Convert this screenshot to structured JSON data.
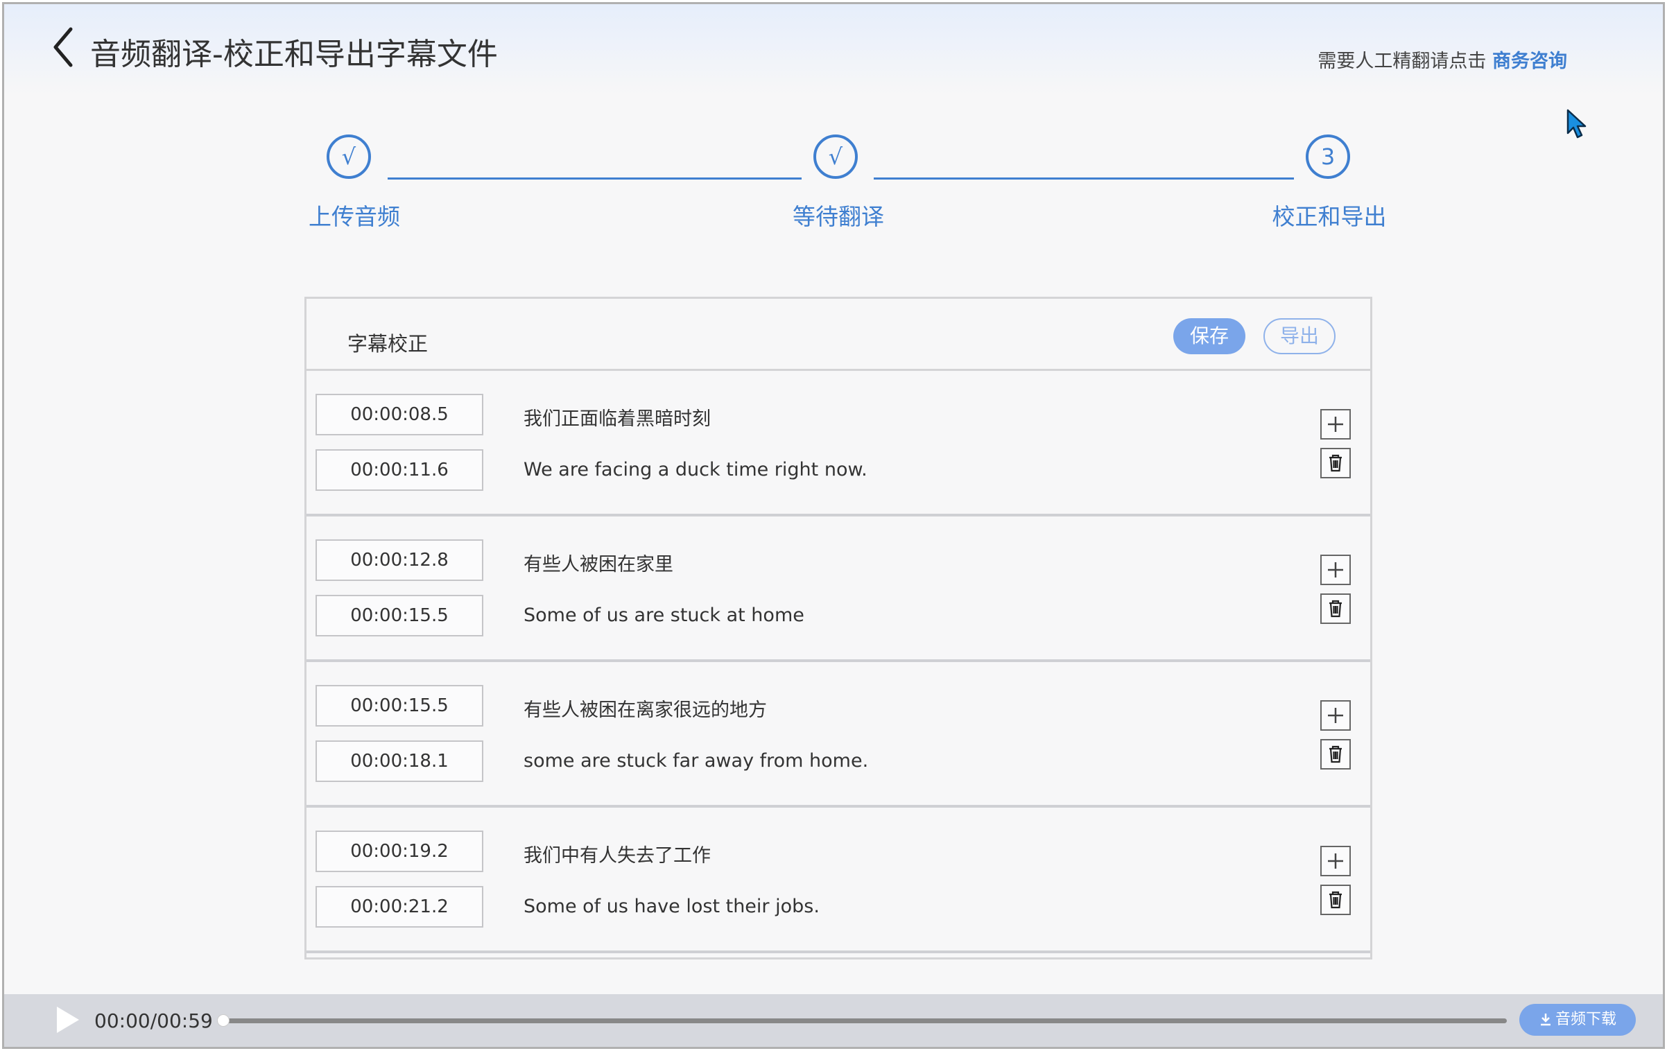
{
  "header": {
    "title": "音频翻译-校正和导出字幕文件",
    "consult_text": "需要人工精翻请点击",
    "consult_link": "商务咨询"
  },
  "steps": [
    {
      "marker": "√",
      "label": "上传音频"
    },
    {
      "marker": "√",
      "label": "等待翻译"
    },
    {
      "marker": "3",
      "label": "校正和导出"
    }
  ],
  "panel": {
    "title": "字幕校正",
    "save_label": "保存",
    "export_label": "导出"
  },
  "segments": [
    {
      "start": "00:00:08.5",
      "end": "00:00:11.6",
      "source": "我们正面临着黑暗时刻",
      "translation": "We are facing a duck time right now."
    },
    {
      "start": "00:00:12.8",
      "end": "00:00:15.5",
      "source": "有些人被困在家里",
      "translation": "Some of us are stuck at home"
    },
    {
      "start": "00:00:15.5",
      "end": "00:00:18.1",
      "source": "有些人被困在离家很远的地方",
      "translation": "some are stuck far away from home."
    },
    {
      "start": "00:00:19.2",
      "end": "00:00:21.2",
      "source": "我们中有人失去了工作",
      "translation": "Some of us have lost their jobs."
    }
  ],
  "player": {
    "time": "00:00/00:59",
    "progress_fraction": 0,
    "download_label": "音频下载"
  },
  "colors": {
    "accent": "#3f7fd0",
    "button_fill": "#7aa5ea",
    "player_bar": "#d6d8de"
  },
  "icons": [
    "back-arrow-icon",
    "plus-icon",
    "trash-icon",
    "play-icon",
    "download-icon",
    "mouse-cursor-icon"
  ]
}
